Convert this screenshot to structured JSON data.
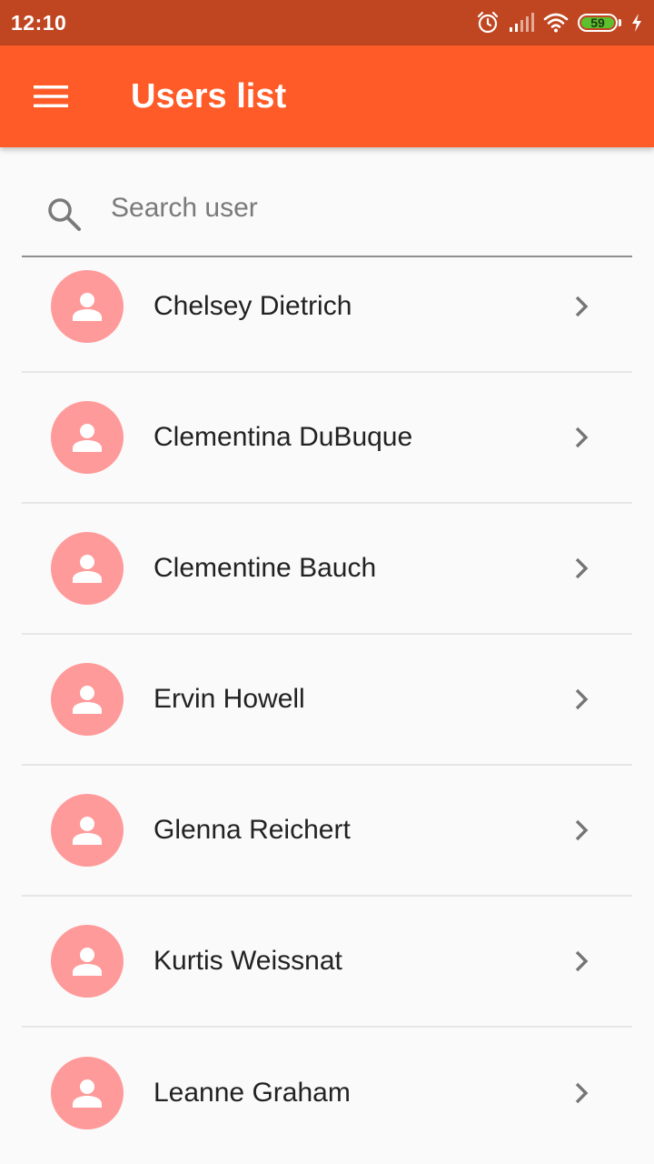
{
  "status_bar": {
    "time": "12:10",
    "battery": "59",
    "icons": [
      "alarm-icon",
      "signal-icon",
      "wifi-icon",
      "battery-icon",
      "charging-icon"
    ]
  },
  "app_bar": {
    "title": "Users list",
    "menu_icon": "menu-icon",
    "color": "#ff5b28"
  },
  "search": {
    "placeholder": "Search user",
    "value": ""
  },
  "users": [
    {
      "name": "Chelsey Dietrich"
    },
    {
      "name": "Clementina DuBuque"
    },
    {
      "name": "Clementine Bauch"
    },
    {
      "name": "Ervin Howell"
    },
    {
      "name": "Glenna Reichert"
    },
    {
      "name": "Kurtis Weissnat"
    },
    {
      "name": "Leanne Graham"
    }
  ],
  "colors": {
    "status_bar": "#bf4621",
    "accent": "#ff5b28",
    "avatar": "#ff9a9a",
    "battery": "#5dc02f"
  }
}
